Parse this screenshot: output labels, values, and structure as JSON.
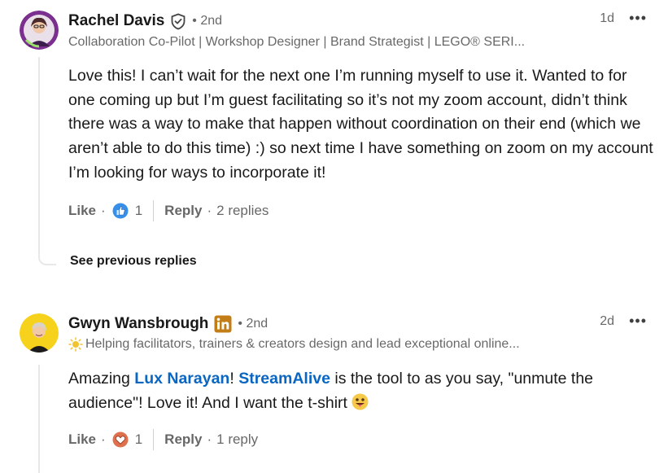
{
  "comments": [
    {
      "author": "Rachel Davis",
      "degree": "• 2nd",
      "headline": "Collaboration Co-Pilot | Workshop Designer | Brand Strategist | LEGO® SERI...",
      "time": "1d",
      "more": "•••",
      "body": "Love this! I can’t wait for the next one I’m running myself to use it. Wanted to for one coming up but I’m guest facilitating so it’s not my zoom account, didn’t think there was a way to make that happen without coordination on their end (which we aren’t able to do this time) :) so next time I have something on zoom on my account I’m looking for ways to incorporate it!",
      "like_label": "Like",
      "reaction_count": "1",
      "reaction_icon": "thumbs-up-icon",
      "reply_label": "Reply",
      "replies": "2 replies"
    },
    {
      "author": "Gwyn Wansbrough",
      "degree": "• 2nd",
      "headline": "Helping facilitators, trainers & creators design and lead exceptional online...",
      "time": "2d",
      "more": "•••",
      "body_parts": {
        "p1": "Amazing ",
        "mention1": "Lux Narayan",
        "p2": "! ",
        "mention2": "StreamAlive",
        "p3": " is the tool to as you say, \"unmute the audience\"! Love it! And I want the t-shirt "
      },
      "like_label": "Like",
      "reaction_count": "1",
      "reaction_icon": "heart-icon",
      "reply_label": "Reply",
      "replies": "1 reply"
    }
  ],
  "see_previous": "See previous replies",
  "separator_dot": "·",
  "colors": {
    "link": "#0a66c2",
    "linkedin_badge": "#c37d16",
    "thread_line": "#e8e8e8"
  }
}
